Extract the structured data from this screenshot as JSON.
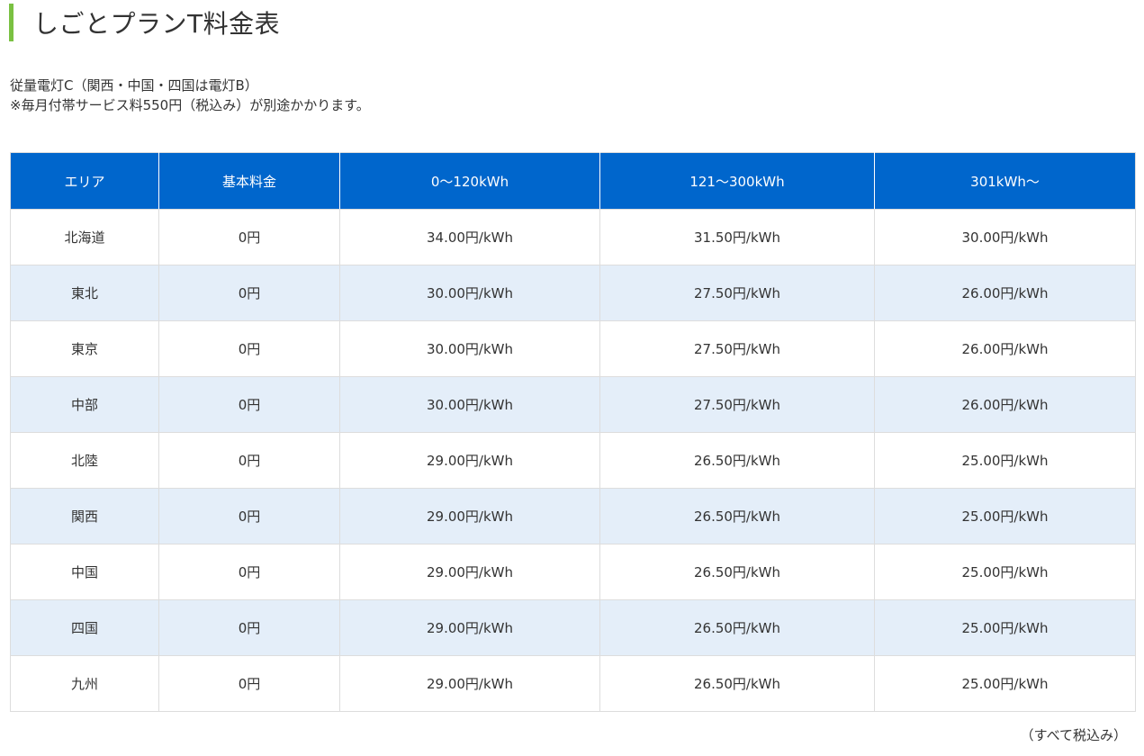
{
  "title": "しごとプランT料金表",
  "notes": {
    "line1": "従量電灯C（関西・中国・四国は電灯B）",
    "line2": "※毎月付帯サービス料550円（税込み）が別途かかります。"
  },
  "table": {
    "headers": [
      "エリア",
      "基本料金",
      "0～120kWh",
      "121～300kWh",
      "301kWh～"
    ],
    "rows": [
      [
        "北海道",
        "0円",
        "34.00円/kWh",
        "31.50円/kWh",
        "30.00円/kWh"
      ],
      [
        "東北",
        "0円",
        "30.00円/kWh",
        "27.50円/kWh",
        "26.00円/kWh"
      ],
      [
        "東京",
        "0円",
        "30.00円/kWh",
        "27.50円/kWh",
        "26.00円/kWh"
      ],
      [
        "中部",
        "0円",
        "30.00円/kWh",
        "27.50円/kWh",
        "26.00円/kWh"
      ],
      [
        "北陸",
        "0円",
        "29.00円/kWh",
        "26.50円/kWh",
        "25.00円/kWh"
      ],
      [
        "関西",
        "0円",
        "29.00円/kWh",
        "26.50円/kWh",
        "25.00円/kWh"
      ],
      [
        "中国",
        "0円",
        "29.00円/kWh",
        "26.50円/kWh",
        "25.00円/kWh"
      ],
      [
        "四国",
        "0円",
        "29.00円/kWh",
        "26.50円/kWh",
        "25.00円/kWh"
      ],
      [
        "九州",
        "0円",
        "29.00円/kWh",
        "26.50円/kWh",
        "25.00円/kWh"
      ]
    ]
  },
  "footer_note": "（すべて税込み）",
  "colors": {
    "accent_bar": "#7ac142",
    "header_bg": "#0066cc",
    "stripe_bg": "#e4eef9"
  }
}
